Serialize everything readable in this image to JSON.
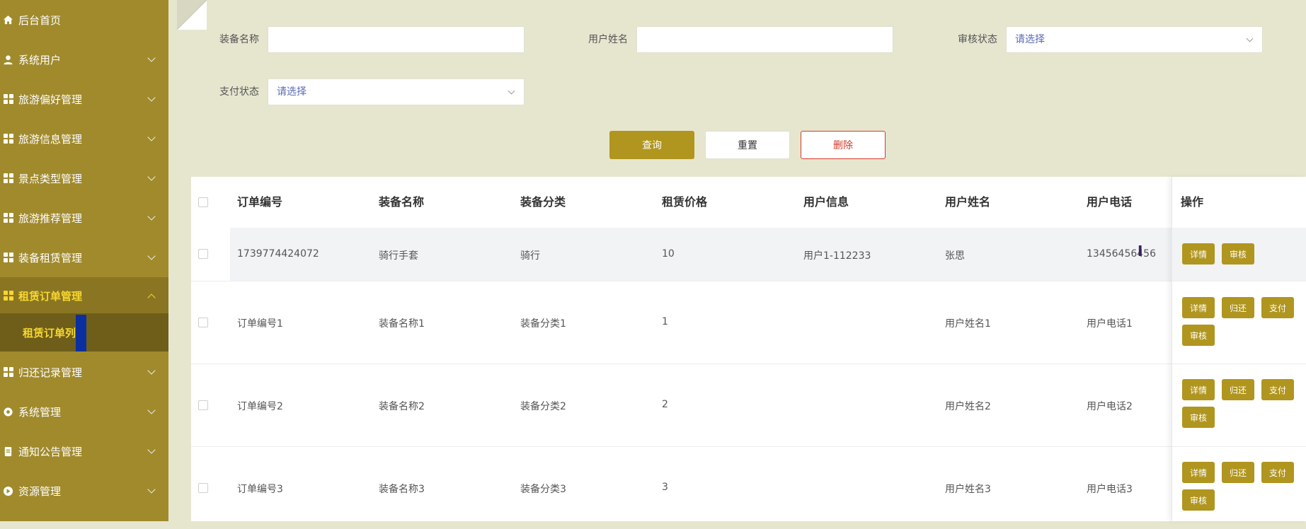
{
  "sidebar": {
    "items": [
      {
        "label": "后台首页",
        "icon": "home-icon"
      },
      {
        "label": "系统用户",
        "icon": "user-icon"
      },
      {
        "label": "旅游偏好管理",
        "icon": "grid-icon"
      },
      {
        "label": "旅游信息管理",
        "icon": "grid-icon"
      },
      {
        "label": "景点类型管理",
        "icon": "grid-icon"
      },
      {
        "label": "旅游推荐管理",
        "icon": "grid-icon"
      },
      {
        "label": "装备租赁管理",
        "icon": "grid-icon"
      },
      {
        "label": "租赁订单管理",
        "icon": "grid-icon"
      },
      {
        "label": "归还记录管理",
        "icon": "grid-icon"
      },
      {
        "label": "系统管理",
        "icon": "settings-icon"
      },
      {
        "label": "通知公告管理",
        "icon": "notice-icon"
      },
      {
        "label": "资源管理",
        "icon": "resource-icon"
      }
    ],
    "submenu_label": "租赁订单列表"
  },
  "filters": {
    "equipment_name_label": "装备名称",
    "equipment_name_value": "",
    "user_name_label": "用户姓名",
    "user_name_value": "",
    "audit_status_label": "审核状态",
    "audit_status_placeholder": "请选择",
    "pay_status_label": "支付状态",
    "pay_status_placeholder": "请选择"
  },
  "buttons": {
    "query": "查询",
    "reset": "重置",
    "delete": "删除"
  },
  "table": {
    "headers": [
      "订单编号",
      "装备名称",
      "装备分类",
      "租赁价格",
      "用户信息",
      "用户姓名",
      "用户电话",
      "操作"
    ],
    "rows": [
      {
        "order_no": "1739774424072",
        "equipment_name": "骑行手套",
        "category": "骑行",
        "price": "10",
        "user_info": "用户1-112233",
        "user_name": "张思",
        "phone": "13456456456",
        "ops": [
          "详情",
          "审核"
        ]
      },
      {
        "order_no": "订单编号1",
        "equipment_name": "装备名称1",
        "category": "装备分类1",
        "price": "1",
        "user_info": "",
        "user_name": "用户姓名1",
        "phone": "用户电话1",
        "ops": [
          "详情",
          "归还",
          "支付",
          "审核"
        ]
      },
      {
        "order_no": "订单编号2",
        "equipment_name": "装备名称2",
        "category": "装备分类2",
        "price": "2",
        "user_info": "",
        "user_name": "用户姓名2",
        "phone": "用户电话2",
        "ops": [
          "详情",
          "归还",
          "支付",
          "审核"
        ]
      },
      {
        "order_no": "订单编号3",
        "equipment_name": "装备名称3",
        "category": "装备分类3",
        "price": "3",
        "user_info": "",
        "user_name": "用户姓名3",
        "phone": "用户电话3",
        "ops": [
          "详情",
          "归还",
          "支付",
          "审核"
        ]
      }
    ]
  },
  "colors": {
    "sidebar": "#a08a2c",
    "active": "#f7d730",
    "primary_button": "#b0951f",
    "danger": "#d23a2a"
  }
}
